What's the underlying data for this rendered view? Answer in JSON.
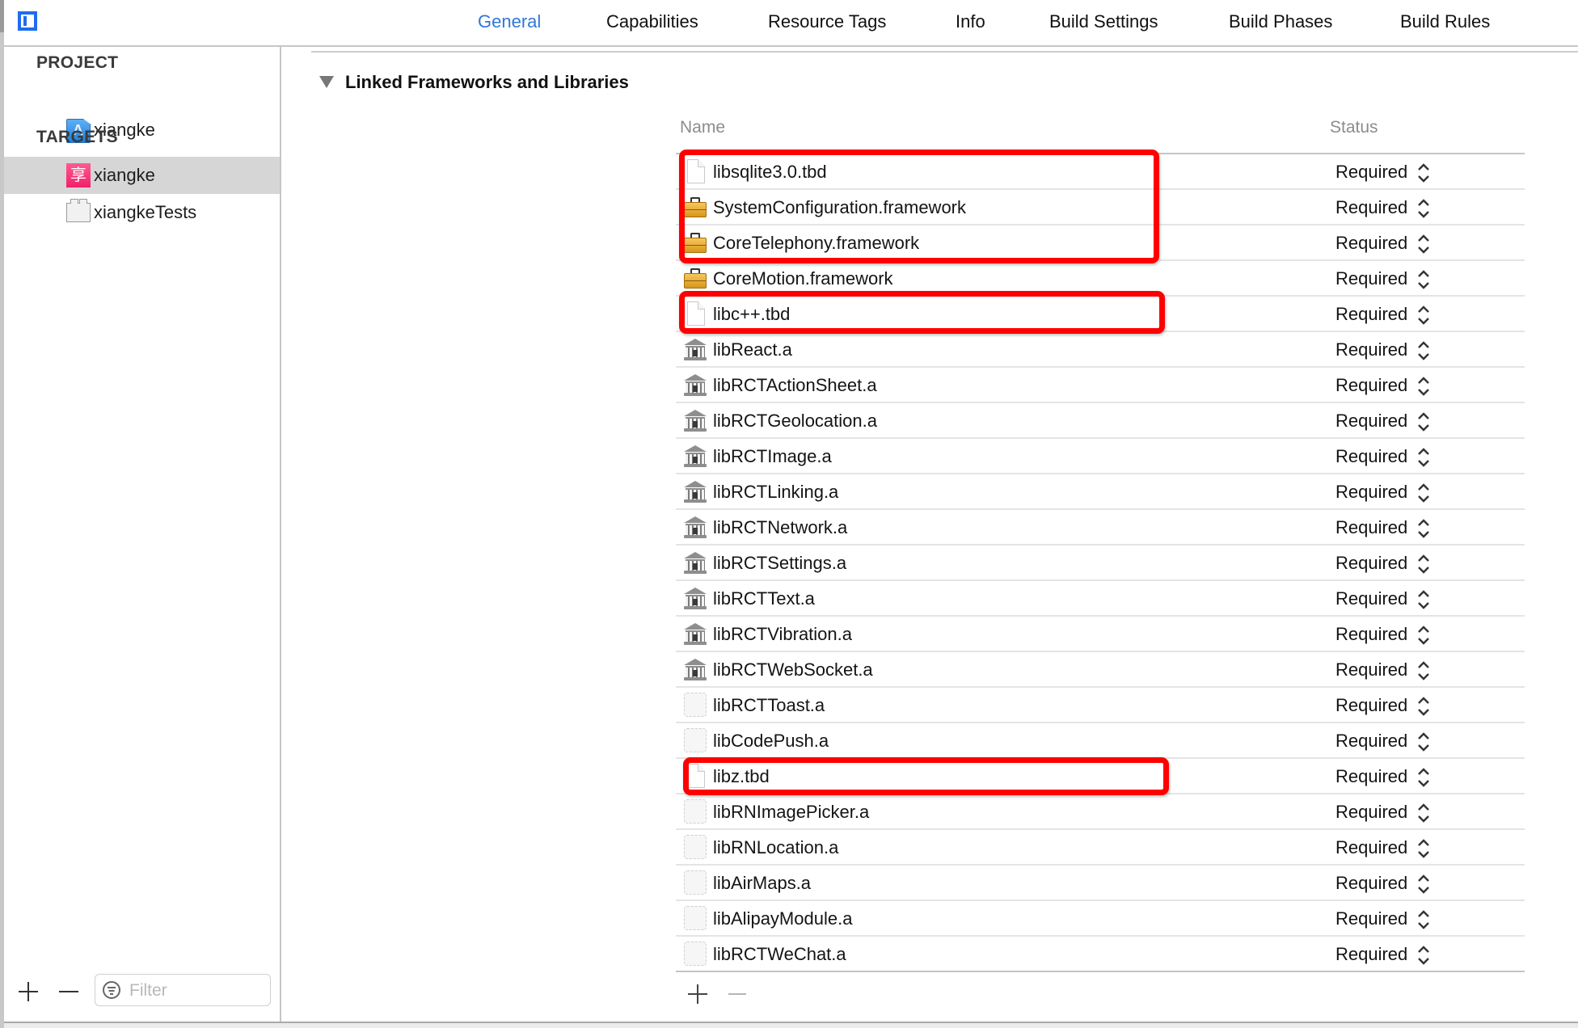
{
  "tabs": [
    {
      "label": "General",
      "active": true
    },
    {
      "label": "Capabilities",
      "active": false
    },
    {
      "label": "Resource Tags",
      "active": false
    },
    {
      "label": "Info",
      "active": false
    },
    {
      "label": "Build Settings",
      "active": false
    },
    {
      "label": "Build Phases",
      "active": false
    },
    {
      "label": "Build Rules",
      "active": false
    }
  ],
  "sidebar": {
    "project_heading": "PROJECT",
    "project_items": [
      {
        "label": "xiangke",
        "icon": "xcode-project-icon"
      }
    ],
    "targets_heading": "TARGETS",
    "target_items": [
      {
        "label": "xiangke",
        "icon": "app-target-icon",
        "icon_glyph": "享",
        "selected": true
      },
      {
        "label": "xiangkeTests",
        "icon": "test-bundle-icon",
        "selected": false
      }
    ],
    "filter_placeholder": "Filter",
    "filter_value": ""
  },
  "section": {
    "title": "Linked Frameworks and Libraries",
    "expanded": true
  },
  "table": {
    "columns": {
      "name": "Name",
      "status": "Status"
    },
    "rows": [
      {
        "name": "libsqlite3.0.tbd",
        "icon": "file",
        "status": "Required"
      },
      {
        "name": "SystemConfiguration.framework",
        "icon": "toolbox",
        "status": "Required"
      },
      {
        "name": "CoreTelephony.framework",
        "icon": "toolbox",
        "status": "Required"
      },
      {
        "name": "CoreMotion.framework",
        "icon": "toolbox",
        "status": "Required"
      },
      {
        "name": "libc++.tbd",
        "icon": "file",
        "status": "Required"
      },
      {
        "name": "libReact.a",
        "icon": "library",
        "status": "Required"
      },
      {
        "name": "libRCTActionSheet.a",
        "icon": "library",
        "status": "Required"
      },
      {
        "name": "libRCTGeolocation.a",
        "icon": "library",
        "status": "Required"
      },
      {
        "name": "libRCTImage.a",
        "icon": "library",
        "status": "Required"
      },
      {
        "name": "libRCTLinking.a",
        "icon": "library",
        "status": "Required"
      },
      {
        "name": "libRCTNetwork.a",
        "icon": "library",
        "status": "Required"
      },
      {
        "name": "libRCTSettings.a",
        "icon": "library",
        "status": "Required"
      },
      {
        "name": "libRCTText.a",
        "icon": "library",
        "status": "Required"
      },
      {
        "name": "libRCTVibration.a",
        "icon": "library",
        "status": "Required"
      },
      {
        "name": "libRCTWebSocket.a",
        "icon": "library",
        "status": "Required"
      },
      {
        "name": "libRCTToast.a",
        "icon": "missing",
        "status": "Required"
      },
      {
        "name": "libCodePush.a",
        "icon": "missing",
        "status": "Required"
      },
      {
        "name": "libz.tbd",
        "icon": "file",
        "status": "Required"
      },
      {
        "name": "libRNImagePicker.a",
        "icon": "missing",
        "status": "Required"
      },
      {
        "name": "libRNLocation.a",
        "icon": "missing",
        "status": "Required"
      },
      {
        "name": "libAirMaps.a",
        "icon": "missing",
        "status": "Required"
      },
      {
        "name": "libAlipayModule.a",
        "icon": "missing",
        "status": "Required"
      },
      {
        "name": "libRCTWeChat.a",
        "icon": "missing",
        "status": "Required"
      }
    ]
  },
  "annotations": {
    "highlight_color": "#ff0000",
    "highlighted_groups": [
      [
        "libsqlite3.0.tbd",
        "SystemConfiguration.framework",
        "CoreTelephony.framework"
      ],
      [
        "libc++.tbd"
      ],
      [
        "libz.tbd"
      ]
    ]
  },
  "colors": {
    "accent": "#2f78d6",
    "selection": "#d6d6d6",
    "toggle": "#1f6cf0"
  }
}
